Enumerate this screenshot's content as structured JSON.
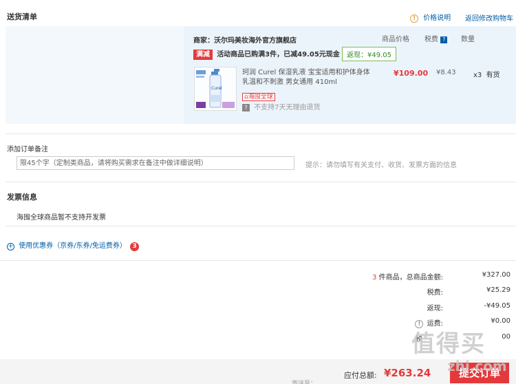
{
  "header": {
    "title": "送货清单",
    "price_note": "价格说明",
    "back_link": "返回修改购物车"
  },
  "shop": {
    "merchant": "商家：沃尔玛美妆海外官方旗舰店",
    "col_price": "商品价格",
    "col_tax": "税费",
    "col_qty": "数量",
    "promo_badge": "满减",
    "promo_text": "活动商品已购满3件，已减49.05元现金",
    "rebate": "返现：¥49.05"
  },
  "item": {
    "name": "珂润 Curel 保湿乳液 宝宝适用和护体身体乳温和不刺激 男女通用 410ml",
    "price": "¥109.00",
    "tax": "¥8.43",
    "qty": "x3",
    "stock": "有货",
    "global_badge": "海囤全球",
    "no_return": "不支持7天无理由退货",
    "return_icon": "?"
  },
  "remark": {
    "label": "添加订单备注",
    "placeholder": "限45个字（定制类商品，请将购买需求在备注中做详细说明）",
    "hint": "提示：请勿填写有关支付、收货、发票方面的信息"
  },
  "invoice": {
    "title": "发票信息",
    "text": "海囤全球商品暂不支持开发票"
  },
  "coupon": {
    "label": "使用优惠券（京券/东券/免运费券）",
    "count": "3"
  },
  "summary": {
    "count": "3",
    "count_suffix": "件商品，总商品金额:",
    "total": "¥327.00",
    "tax_label": "税费:",
    "tax": "¥25.29",
    "rebate_label": "返现:",
    "rebate": "-¥49.05",
    "ship_label": "运费:",
    "ship": "¥0.00",
    "partial_label": "税",
    "partial_val": "00"
  },
  "footer": {
    "pay_label": "应付总额:",
    "pay_value": "¥263.24",
    "submit": "提交订单",
    "note": "寄送至："
  },
  "watermark": {
    "text": "值得买",
    "site": "zhi.com"
  }
}
